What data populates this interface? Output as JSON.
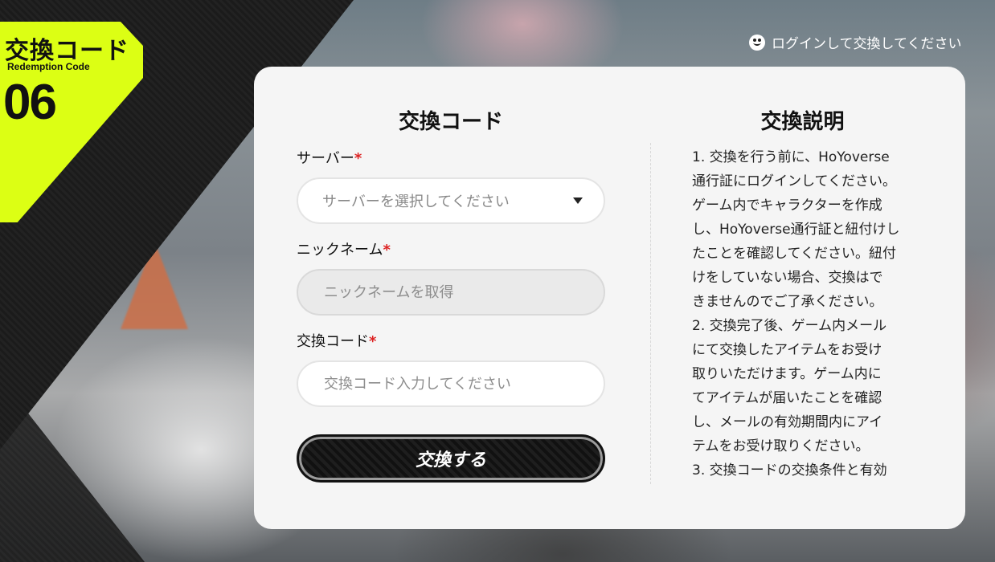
{
  "badge": {
    "title": "交換コード",
    "subtitle": "Redemption Code",
    "number": "06"
  },
  "header": {
    "login_text": "ログインして交換してください",
    "login_icon": "user-bear-icon"
  },
  "form": {
    "heading": "交換コード",
    "server": {
      "label": "サーバー",
      "required_mark": "*",
      "placeholder": "サーバーを選択してください"
    },
    "nickname": {
      "label": "ニックネーム",
      "required_mark": "*",
      "placeholder": "ニックネームを取得"
    },
    "code": {
      "label": "交換コード",
      "required_mark": "*",
      "placeholder": "交換コード入力してください"
    },
    "submit_label": "交換する"
  },
  "instructions": {
    "heading": "交換説明",
    "lines": [
      "1. 交換を行う前に、HoYoverse",
      "通行証にログインしてください。",
      "ゲーム内でキャラクターを作成",
      "し、HoYoverse通行証と紐付けし",
      "たことを確認してください。紐付",
      "けをしていない場合、交換はで",
      "きませんのでご了承ください。",
      "2. 交換完了後、ゲーム内メール",
      "にて交換したアイテムをお受け",
      "取りいただけます。ゲーム内に",
      "てアイテムが届いたことを確認",
      "し、メールの有効期間内にアイ",
      "テムをお受け取りください。",
      "3. 交換コードの交換条件と有効"
    ]
  },
  "colors": {
    "accent": "#dcff14",
    "required": "#dd2222",
    "card": "#f5f5f5"
  }
}
